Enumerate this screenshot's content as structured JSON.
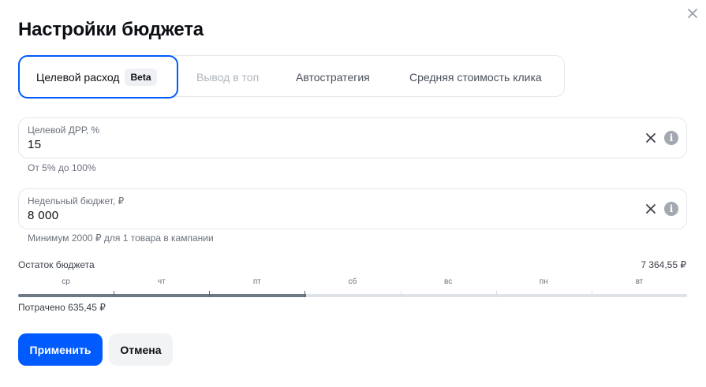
{
  "modal": {
    "title": "Настройки бюджета",
    "close_icon": "close-icon"
  },
  "tabs": [
    {
      "label": "Целевой расход",
      "badge": "Beta",
      "state": "active"
    },
    {
      "label": "Вывод в топ",
      "state": "disabled"
    },
    {
      "label": "Автостратегия",
      "state": "normal"
    },
    {
      "label": "Средняя стоимость клика",
      "state": "normal"
    }
  ],
  "drr_field": {
    "label": "Целевой ДРР, %",
    "value": "15",
    "hint": "От 5% до 100%",
    "clear_icon": "close-icon",
    "info_icon": "info-icon"
  },
  "budget_field": {
    "label": "Недельный бюджет, ₽",
    "value": "8 000",
    "hint": "Минимум 2000 ₽ для 1 товара в кампании",
    "clear_icon": "close-icon",
    "info_icon": "info-icon"
  },
  "budget_remaining": {
    "label": "Остаток бюджета",
    "value": "7 364,55 ₽"
  },
  "timeline": {
    "days": [
      "ср",
      "чт",
      "пт",
      "сб",
      "вс",
      "пн",
      "вт"
    ],
    "spent_fraction": 0.43
  },
  "spent": {
    "text": "Потрачено 635,45 ₽"
  },
  "buttons": {
    "apply": "Применить",
    "cancel": "Отмена"
  },
  "colors": {
    "accent": "#005bff",
    "progress_fill": "#6f7886",
    "progress_track": "#dfe3e8",
    "info_icon": "#a4a9b1"
  }
}
